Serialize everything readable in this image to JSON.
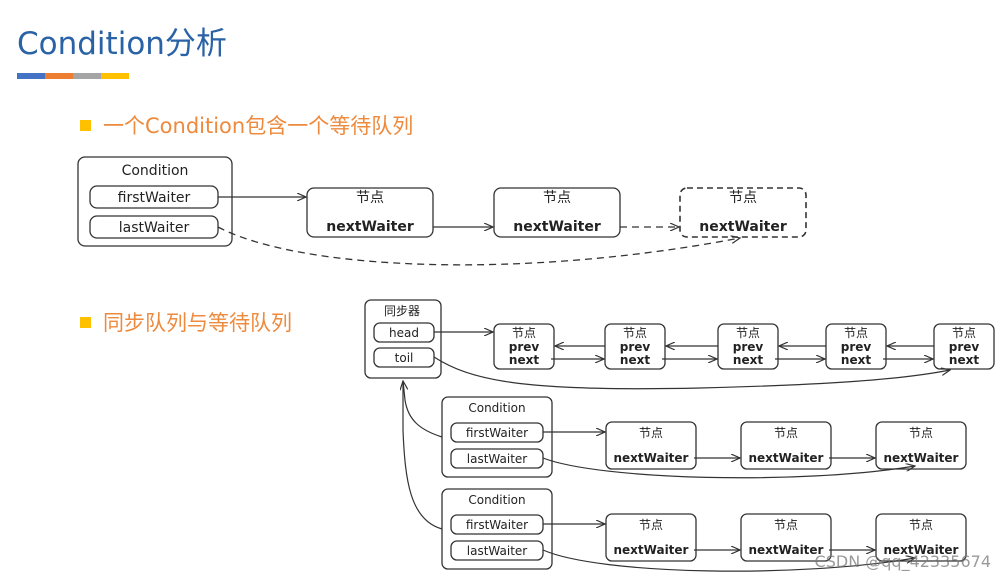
{
  "slide": {
    "title": "Condition分析",
    "accent_colors": [
      "#4472c4",
      "#ed7d31",
      "#a5a5a5",
      "#ffc000"
    ],
    "bullets": [
      {
        "text": "一个Condition包含一个等待队列"
      },
      {
        "text": "同步队列与等待队列"
      }
    ],
    "watermark": "CSDN @qq_42335674"
  },
  "diagram1": {
    "condition_label": "Condition",
    "fields": [
      "firstWaiter",
      "lastWaiter"
    ],
    "nodes": [
      {
        "title": "节点",
        "field": "nextWaiter",
        "style": "solid"
      },
      {
        "title": "节点",
        "field": "nextWaiter",
        "style": "solid"
      },
      {
        "title": "节点",
        "field": "nextWaiter",
        "style": "dashed"
      }
    ]
  },
  "diagram2": {
    "sync_label": "同步器",
    "sync_fields": [
      "head",
      "tail_label_shown"
    ],
    "head_label": "head",
    "tail_label": "toil",
    "sync_nodes": [
      {
        "title": "节点",
        "prev": "prev",
        "next": "next"
      },
      {
        "title": "节点",
        "prev": "prev",
        "next": "next"
      },
      {
        "title": "节点",
        "prev": "prev",
        "next": "next"
      },
      {
        "title": "节点",
        "prev": "prev",
        "next": "next"
      },
      {
        "title": "节点",
        "prev": "prev",
        "next": "next"
      }
    ],
    "conditions": [
      {
        "label": "Condition",
        "first": "firstWaiter",
        "last": "lastWaiter",
        "nodes": [
          {
            "title": "节点",
            "field": "nextWaiter"
          },
          {
            "title": "节点",
            "field": "nextWaiter"
          },
          {
            "title": "节点",
            "field": "nextWaiter"
          }
        ]
      },
      {
        "label": "Condition",
        "first": "firstWaiter",
        "last": "lastWaiter",
        "nodes": [
          {
            "title": "节点",
            "field": "nextWaiter"
          },
          {
            "title": "节点",
            "field": "nextWaiter"
          },
          {
            "title": "节点",
            "field": "nextWaiter"
          }
        ]
      }
    ]
  }
}
